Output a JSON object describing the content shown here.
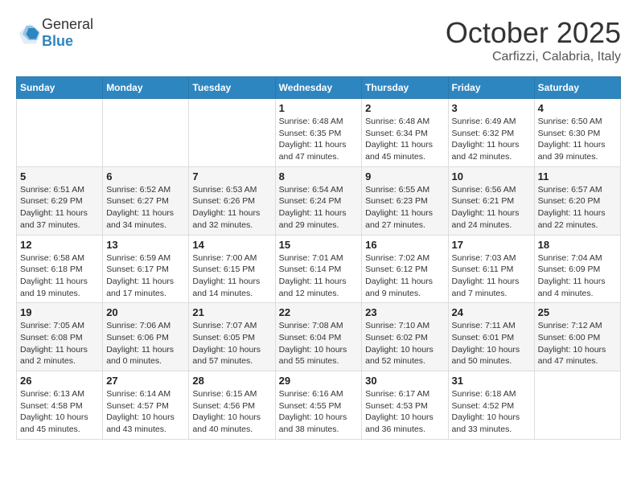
{
  "header": {
    "logo": {
      "general": "General",
      "blue": "Blue"
    },
    "title": "October 2025",
    "subtitle": "Carfizzi, Calabria, Italy"
  },
  "calendar": {
    "days_of_week": [
      "Sunday",
      "Monday",
      "Tuesday",
      "Wednesday",
      "Thursday",
      "Friday",
      "Saturday"
    ],
    "weeks": [
      [
        {
          "day": "",
          "info": ""
        },
        {
          "day": "",
          "info": ""
        },
        {
          "day": "",
          "info": ""
        },
        {
          "day": "1",
          "info": "Sunrise: 6:48 AM\nSunset: 6:35 PM\nDaylight: 11 hours and 47 minutes."
        },
        {
          "day": "2",
          "info": "Sunrise: 6:48 AM\nSunset: 6:34 PM\nDaylight: 11 hours and 45 minutes."
        },
        {
          "day": "3",
          "info": "Sunrise: 6:49 AM\nSunset: 6:32 PM\nDaylight: 11 hours and 42 minutes."
        },
        {
          "day": "4",
          "info": "Sunrise: 6:50 AM\nSunset: 6:30 PM\nDaylight: 11 hours and 39 minutes."
        }
      ],
      [
        {
          "day": "5",
          "info": "Sunrise: 6:51 AM\nSunset: 6:29 PM\nDaylight: 11 hours and 37 minutes."
        },
        {
          "day": "6",
          "info": "Sunrise: 6:52 AM\nSunset: 6:27 PM\nDaylight: 11 hours and 34 minutes."
        },
        {
          "day": "7",
          "info": "Sunrise: 6:53 AM\nSunset: 6:26 PM\nDaylight: 11 hours and 32 minutes."
        },
        {
          "day": "8",
          "info": "Sunrise: 6:54 AM\nSunset: 6:24 PM\nDaylight: 11 hours and 29 minutes."
        },
        {
          "day": "9",
          "info": "Sunrise: 6:55 AM\nSunset: 6:23 PM\nDaylight: 11 hours and 27 minutes."
        },
        {
          "day": "10",
          "info": "Sunrise: 6:56 AM\nSunset: 6:21 PM\nDaylight: 11 hours and 24 minutes."
        },
        {
          "day": "11",
          "info": "Sunrise: 6:57 AM\nSunset: 6:20 PM\nDaylight: 11 hours and 22 minutes."
        }
      ],
      [
        {
          "day": "12",
          "info": "Sunrise: 6:58 AM\nSunset: 6:18 PM\nDaylight: 11 hours and 19 minutes."
        },
        {
          "day": "13",
          "info": "Sunrise: 6:59 AM\nSunset: 6:17 PM\nDaylight: 11 hours and 17 minutes."
        },
        {
          "day": "14",
          "info": "Sunrise: 7:00 AM\nSunset: 6:15 PM\nDaylight: 11 hours and 14 minutes."
        },
        {
          "day": "15",
          "info": "Sunrise: 7:01 AM\nSunset: 6:14 PM\nDaylight: 11 hours and 12 minutes."
        },
        {
          "day": "16",
          "info": "Sunrise: 7:02 AM\nSunset: 6:12 PM\nDaylight: 11 hours and 9 minutes."
        },
        {
          "day": "17",
          "info": "Sunrise: 7:03 AM\nSunset: 6:11 PM\nDaylight: 11 hours and 7 minutes."
        },
        {
          "day": "18",
          "info": "Sunrise: 7:04 AM\nSunset: 6:09 PM\nDaylight: 11 hours and 4 minutes."
        }
      ],
      [
        {
          "day": "19",
          "info": "Sunrise: 7:05 AM\nSunset: 6:08 PM\nDaylight: 11 hours and 2 minutes."
        },
        {
          "day": "20",
          "info": "Sunrise: 7:06 AM\nSunset: 6:06 PM\nDaylight: 11 hours and 0 minutes."
        },
        {
          "day": "21",
          "info": "Sunrise: 7:07 AM\nSunset: 6:05 PM\nDaylight: 10 hours and 57 minutes."
        },
        {
          "day": "22",
          "info": "Sunrise: 7:08 AM\nSunset: 6:04 PM\nDaylight: 10 hours and 55 minutes."
        },
        {
          "day": "23",
          "info": "Sunrise: 7:10 AM\nSunset: 6:02 PM\nDaylight: 10 hours and 52 minutes."
        },
        {
          "day": "24",
          "info": "Sunrise: 7:11 AM\nSunset: 6:01 PM\nDaylight: 10 hours and 50 minutes."
        },
        {
          "day": "25",
          "info": "Sunrise: 7:12 AM\nSunset: 6:00 PM\nDaylight: 10 hours and 47 minutes."
        }
      ],
      [
        {
          "day": "26",
          "info": "Sunrise: 6:13 AM\nSunset: 4:58 PM\nDaylight: 10 hours and 45 minutes."
        },
        {
          "day": "27",
          "info": "Sunrise: 6:14 AM\nSunset: 4:57 PM\nDaylight: 10 hours and 43 minutes."
        },
        {
          "day": "28",
          "info": "Sunrise: 6:15 AM\nSunset: 4:56 PM\nDaylight: 10 hours and 40 minutes."
        },
        {
          "day": "29",
          "info": "Sunrise: 6:16 AM\nSunset: 4:55 PM\nDaylight: 10 hours and 38 minutes."
        },
        {
          "day": "30",
          "info": "Sunrise: 6:17 AM\nSunset: 4:53 PM\nDaylight: 10 hours and 36 minutes."
        },
        {
          "day": "31",
          "info": "Sunrise: 6:18 AM\nSunset: 4:52 PM\nDaylight: 10 hours and 33 minutes."
        },
        {
          "day": "",
          "info": ""
        }
      ]
    ]
  }
}
